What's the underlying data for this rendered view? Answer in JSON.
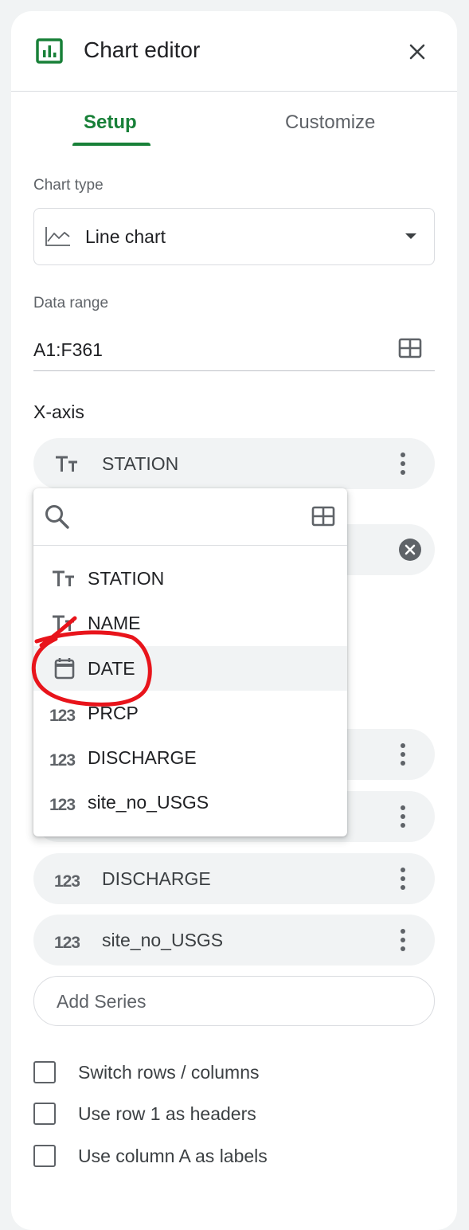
{
  "header": {
    "title": "Chart editor",
    "icon": "chart-icon"
  },
  "tabs": [
    {
      "label": "Setup",
      "active": true
    },
    {
      "label": "Customize",
      "active": false
    }
  ],
  "chart_type": {
    "label": "Chart type",
    "value": "Line chart",
    "icon": "line-chart-icon"
  },
  "data_range": {
    "label": "Data range",
    "value": "A1:F361"
  },
  "x_axis": {
    "title": "X-axis",
    "chip": {
      "label": "STATION",
      "icon": "text-type-icon"
    }
  },
  "series": [
    {
      "label": "DISCHARGE",
      "icon": "number-type-icon"
    },
    {
      "label": "site_no_USGS",
      "icon": "number-type-icon"
    }
  ],
  "add_series_label": "Add Series",
  "checkboxes": [
    {
      "label": "Switch rows / columns",
      "checked": false
    },
    {
      "label": "Use row 1 as headers",
      "checked": false
    },
    {
      "label": "Use column A as labels",
      "checked": false
    }
  ],
  "dropdown": {
    "search_value": "",
    "items": [
      {
        "label": "STATION",
        "icon": "text-type-icon"
      },
      {
        "label": "NAME",
        "icon": "text-type-icon"
      },
      {
        "label": "DATE",
        "icon": "calendar-icon",
        "highlighted": true
      },
      {
        "label": "PRCP",
        "icon": "number-type-icon"
      },
      {
        "label": "DISCHARGE",
        "icon": "number-type-icon"
      },
      {
        "label": "site_no_USGS",
        "icon": "number-type-icon"
      }
    ]
  },
  "colors": {
    "accent": "#188038",
    "annotation": "#e8141b",
    "chip_bg": "#f1f3f4",
    "highlight_bg": "#f1f3f4"
  }
}
